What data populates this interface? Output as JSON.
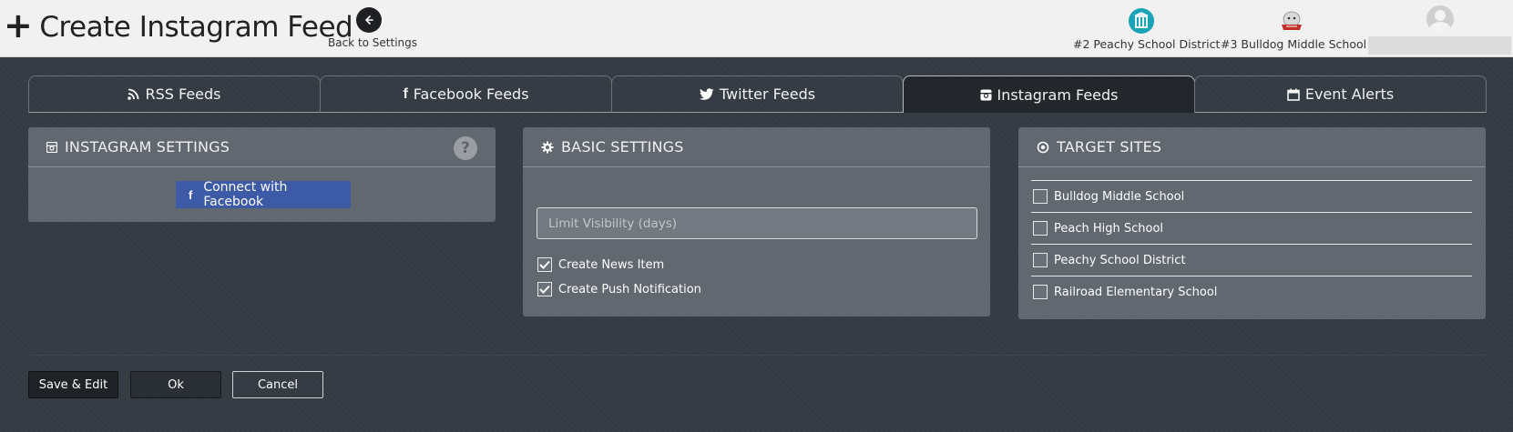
{
  "header": {
    "title": "Create Instagram Feed",
    "back_label": "Back to Settings",
    "sites": [
      {
        "label": "#2 Peachy School District",
        "logo": "building-logo",
        "color": "#1aa3b6"
      },
      {
        "label": "#3 Bulldog Middle School",
        "logo": "bulldog-logo",
        "color": "#c0302b"
      }
    ],
    "user_icon": "avatar-icon"
  },
  "tabs": [
    {
      "label": "RSS Feeds",
      "icon": "rss-icon",
      "active": false
    },
    {
      "label": "Facebook Feeds",
      "icon": "facebook-icon",
      "active": false
    },
    {
      "label": "Twitter Feeds",
      "icon": "twitter-icon",
      "active": false
    },
    {
      "label": "Instagram Feeds",
      "icon": "instagram-icon",
      "active": true
    },
    {
      "label": "Event Alerts",
      "icon": "calendar-icon",
      "active": false
    }
  ],
  "instagram_settings": {
    "title": "INSTAGRAM SETTINGS",
    "help": "?",
    "connect_label": "Connect with Facebook",
    "connect_color": "#3c5aa6"
  },
  "basic_settings": {
    "title": "BASIC SETTINGS",
    "limit_placeholder": "Limit Visibility (days)",
    "checks": [
      {
        "label": "Create News Item",
        "checked": true
      },
      {
        "label": "Create Push Notification",
        "checked": true
      }
    ]
  },
  "target_sites": {
    "title": "TARGET SITES",
    "sites": [
      {
        "label": "Bulldog Middle School",
        "checked": false
      },
      {
        "label": "Peach High School",
        "checked": false
      },
      {
        "label": "Peachy School District",
        "checked": false
      },
      {
        "label": "Railroad Elementary School",
        "checked": false
      }
    ]
  },
  "footer": {
    "save_edit": "Save & Edit",
    "ok": "Ok",
    "cancel": "Cancel"
  }
}
